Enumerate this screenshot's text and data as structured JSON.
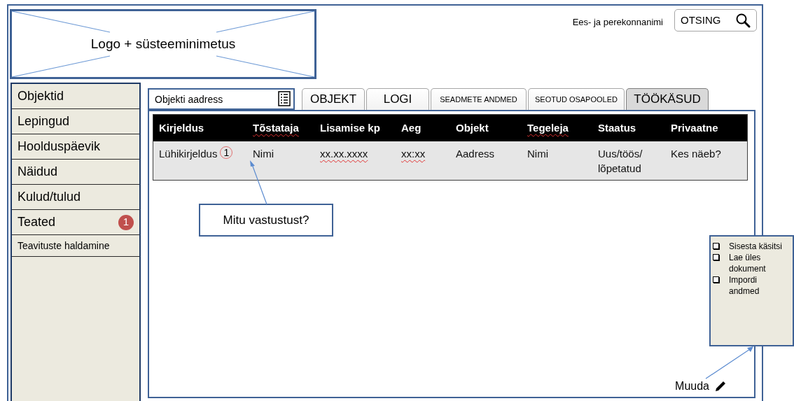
{
  "logo": {
    "text": "Logo + süsteeminimetus"
  },
  "user": {
    "name": "Ees- ja perekonnanimi"
  },
  "search_button": {
    "label": "OTSING"
  },
  "sidebar": {
    "items": [
      {
        "label": "Objektid",
        "kind": "main"
      },
      {
        "label": "Lepingud",
        "kind": "main"
      },
      {
        "label": "Hoolduspäevik",
        "kind": "main"
      },
      {
        "label": "Näidud",
        "kind": "main"
      },
      {
        "label": "Kulud/tulud",
        "kind": "main"
      },
      {
        "label": "Teated",
        "kind": "main",
        "badge": "1"
      },
      {
        "label": "Teavituste haldamine",
        "kind": "sub"
      }
    ]
  },
  "address_field": {
    "placeholder": "Objekti aadress"
  },
  "tabs": [
    {
      "label": "OBJEKT",
      "kind": "large",
      "selected": false
    },
    {
      "label": "LOGI",
      "kind": "large",
      "selected": false
    },
    {
      "label": "SEADMETE ANDMED",
      "kind": "small",
      "selected": false
    },
    {
      "label": "SEOTUD OSAPOOLED",
      "kind": "small",
      "selected": false
    },
    {
      "label": "TÖÖKÄSUD",
      "kind": "large",
      "selected": true
    }
  ],
  "table": {
    "columns": [
      {
        "label": "Kirjeldus",
        "flagged": false
      },
      {
        "label": "Tõstataja",
        "flagged": true
      },
      {
        "label": "Lisamise kp",
        "flagged": false
      },
      {
        "label": "Aeg",
        "flagged": false
      },
      {
        "label": "Objekt",
        "flagged": false
      },
      {
        "label": "Tegeleja",
        "flagged": true
      },
      {
        "label": "Staatus",
        "flagged": false
      },
      {
        "label": "Privaatne",
        "flagged": false
      }
    ],
    "rows": [
      {
        "cells": [
          {
            "text": "Lühikirjeldus",
            "flagged": false,
            "count": "1"
          },
          {
            "text": "Nimi",
            "flagged": false
          },
          {
            "text": "xx.xx.xxxx",
            "flagged": true
          },
          {
            "text": "xx:xx",
            "flagged": true
          },
          {
            "text": "Aadress",
            "flagged": false
          },
          {
            "text": "Nimi",
            "flagged": false
          },
          {
            "text": "Uus/töös/ lõpetatud",
            "flagged": false
          },
          {
            "text": "Kes näeb?",
            "flagged": false
          }
        ]
      }
    ]
  },
  "callout": {
    "text": "Mitu vastustust?"
  },
  "edit_link": {
    "label": "Muuda"
  },
  "edit_menu": {
    "options": [
      {
        "label": "Sisesta käsitsi",
        "checked": false
      },
      {
        "label": "Lae üles dokument",
        "checked": false
      },
      {
        "label": "Impordi andmed",
        "checked": false
      }
    ]
  }
}
